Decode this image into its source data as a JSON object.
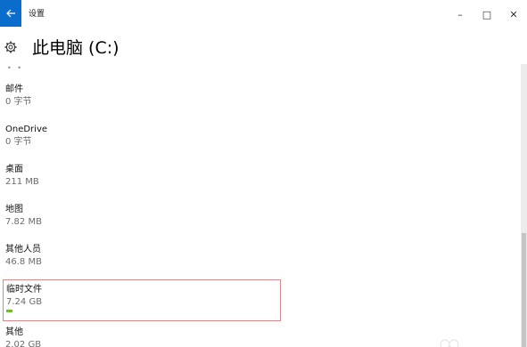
{
  "window": {
    "app_title": "设置",
    "controls": {
      "minimize": "–",
      "maximize": "□",
      "close": "✕"
    }
  },
  "header": {
    "icon": "gear-icon",
    "title": "此电脑 (C:)"
  },
  "storage_items": [
    {
      "name": "邮件",
      "size": "0 字节",
      "selected": false
    },
    {
      "name": "OneDrive",
      "size": "0 字节",
      "selected": false
    },
    {
      "name": "桌面",
      "size": "211 MB",
      "selected": false
    },
    {
      "name": "地图",
      "size": "7.82 MB",
      "selected": false
    },
    {
      "name": "其他人员",
      "size": "46.8 MB",
      "selected": false
    },
    {
      "name": "临时文件",
      "size": "7.24 GB",
      "selected": true,
      "usage_fraction": 0.025
    },
    {
      "name": "其他",
      "size": "2.02 GB",
      "selected": false
    }
  ],
  "colors": {
    "accent": "#0a6ccb",
    "usage_bar": "#6cbf2b",
    "selection_border": "#d48a8a",
    "secondary_text": "#6b6b6b"
  }
}
